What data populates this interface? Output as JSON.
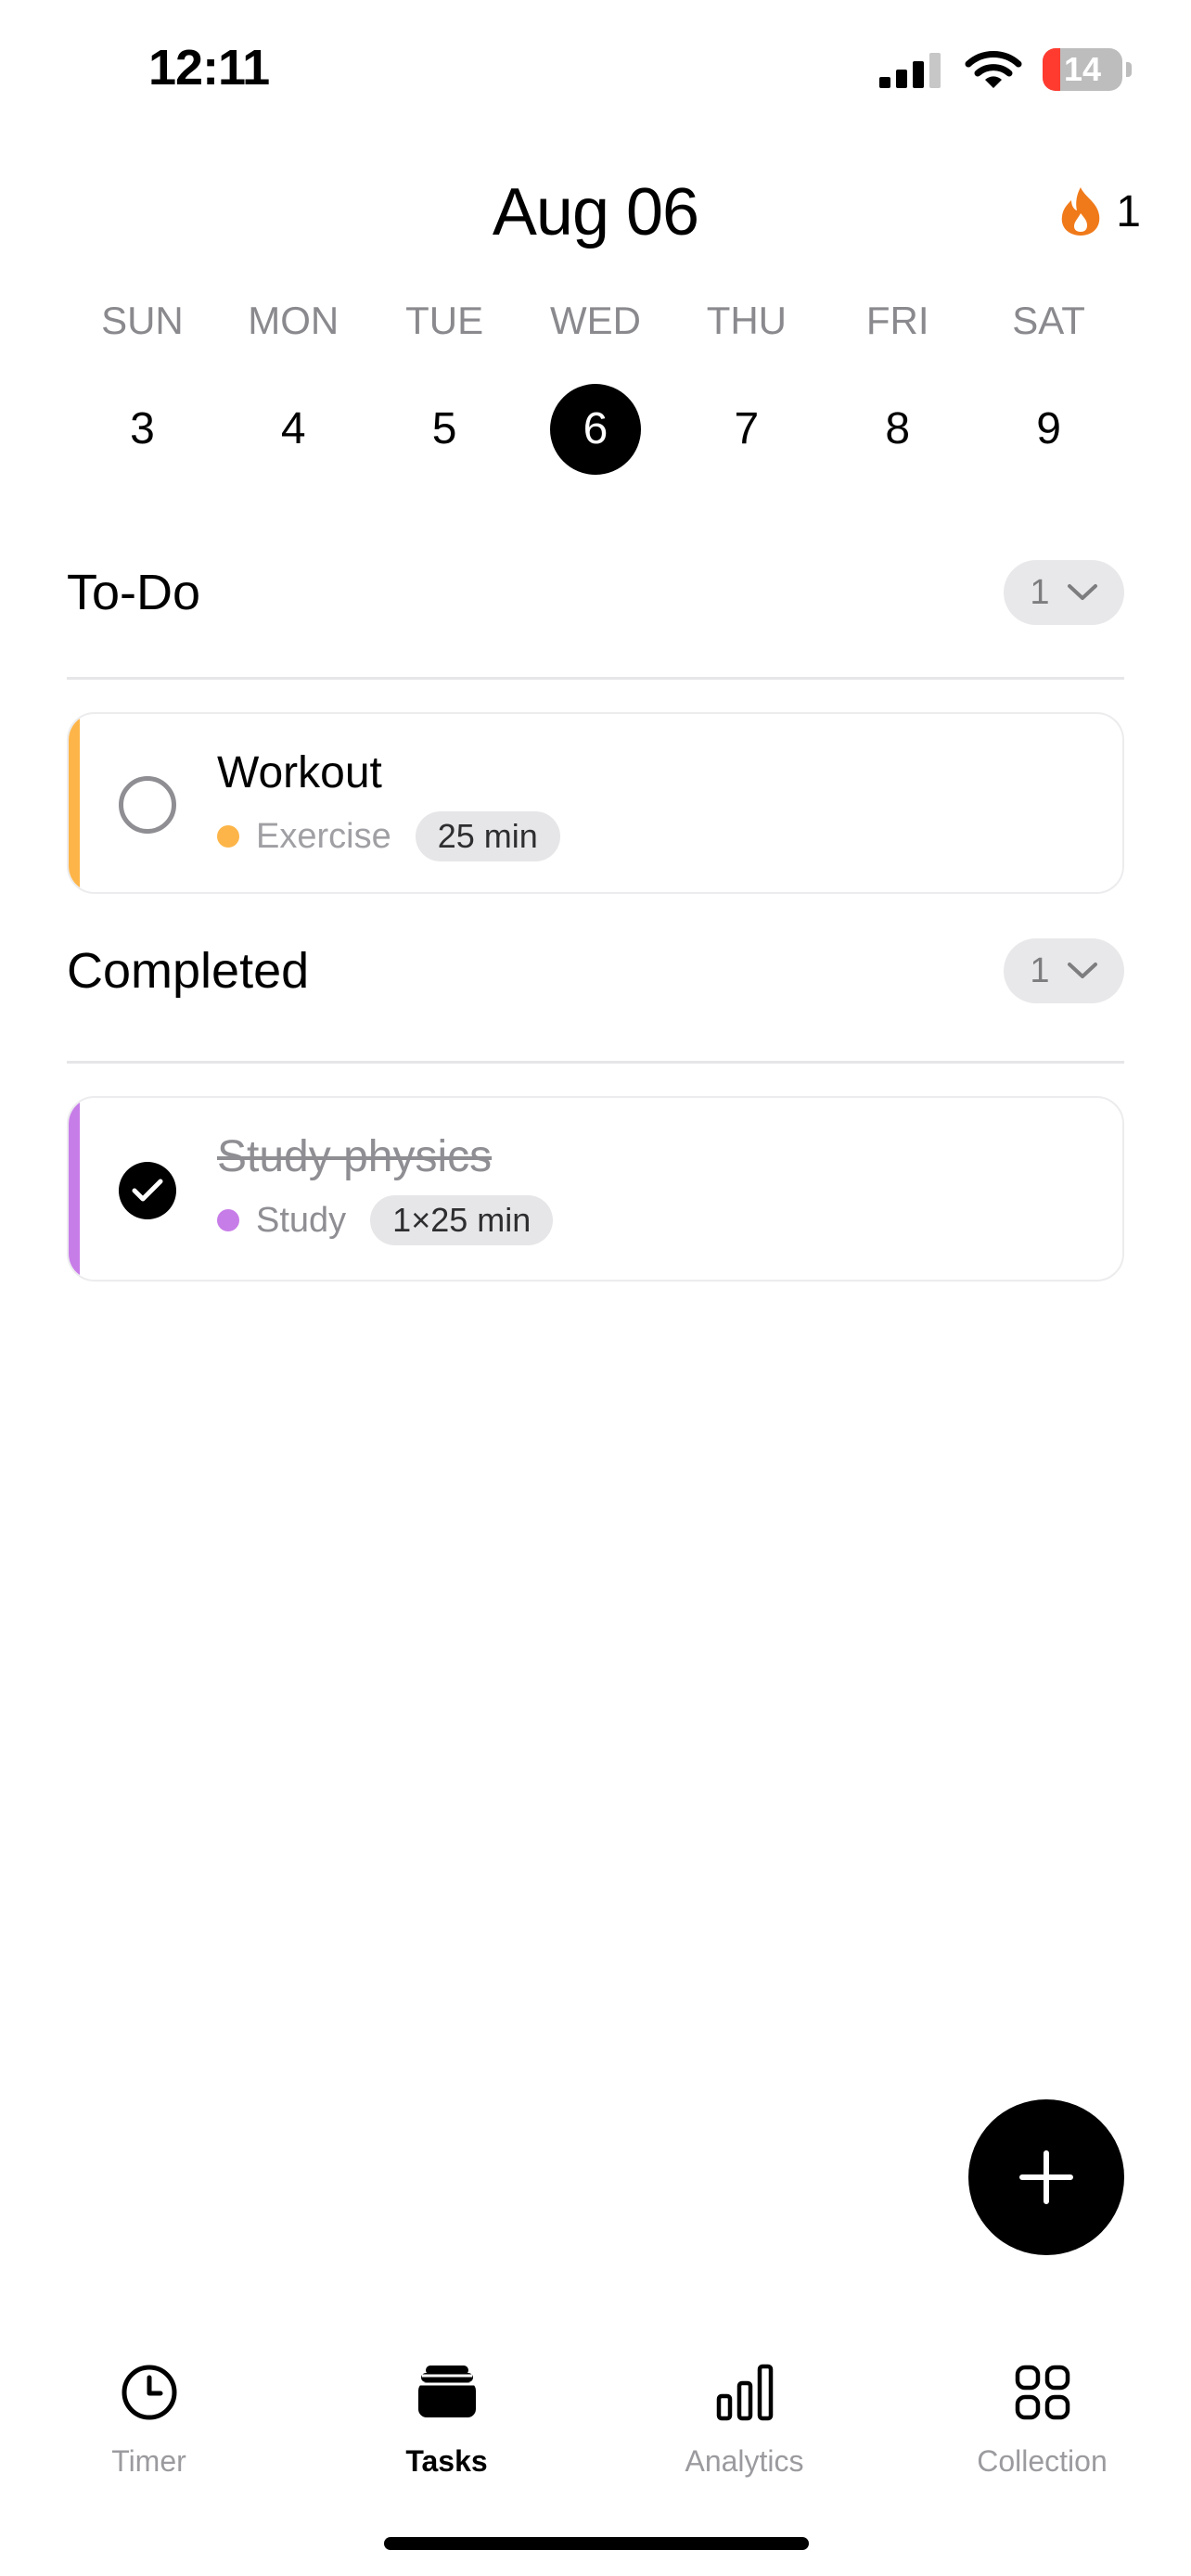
{
  "status_bar": {
    "time": "12:11",
    "battery": "14"
  },
  "header": {
    "date_title": "Aug 06",
    "streak_count": "1"
  },
  "week": {
    "days": [
      {
        "dow": "SUN",
        "num": "3"
      },
      {
        "dow": "MON",
        "num": "4"
      },
      {
        "dow": "TUE",
        "num": "5"
      },
      {
        "dow": "WED",
        "num": "6"
      },
      {
        "dow": "THU",
        "num": "7"
      },
      {
        "dow": "FRI",
        "num": "8"
      },
      {
        "dow": "SAT",
        "num": "9"
      }
    ],
    "selected": "6"
  },
  "todo": {
    "title": "To-Do",
    "count": "1",
    "tasks": [
      {
        "title": "Workout",
        "category": "Exercise",
        "duration": "25 min",
        "accent": "#FDB549",
        "completed": false
      }
    ]
  },
  "completed": {
    "title": "Completed",
    "count": "1",
    "tasks": [
      {
        "title": "Study physics",
        "category": "Study",
        "duration": "1×25 min",
        "accent": "#C77DE8",
        "completed": true
      }
    ]
  },
  "tabs": [
    {
      "label": "Timer",
      "icon": "clock-icon"
    },
    {
      "label": "Tasks",
      "icon": "tasks-stack-icon",
      "active": true
    },
    {
      "label": "Analytics",
      "icon": "bar-chart-icon"
    },
    {
      "label": "Collection",
      "icon": "grid-icon"
    }
  ],
  "colors": {
    "streak": "#F07A1A",
    "accent_exercise": "#FDB549",
    "accent_study": "#C77DE8"
  }
}
